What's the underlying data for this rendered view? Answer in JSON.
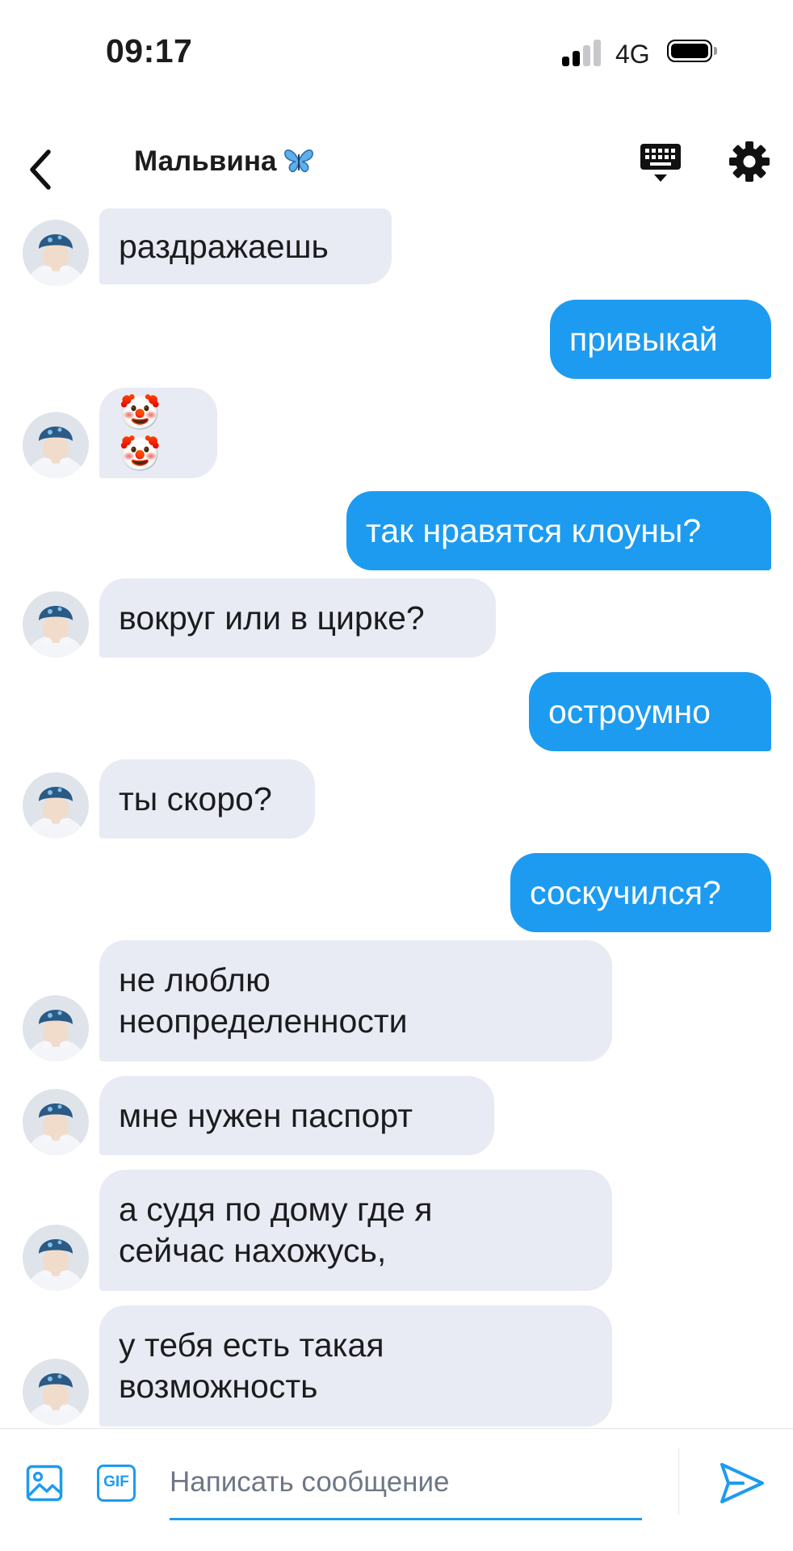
{
  "status_bar": {
    "time": "09:17",
    "network": "4G",
    "signal_level": "2 of 4 bars",
    "battery_level": 0.85
  },
  "header": {
    "contact_name": "Мальвина",
    "back_icon": "chevron-left-icon",
    "keyboard_icon": "keyboard-icon",
    "settings_icon": "gear-icon"
  },
  "messages": [
    {
      "direction": "in",
      "text": "раздражаешь"
    },
    {
      "direction": "out",
      "text": "привыкай"
    },
    {
      "direction": "in",
      "text": "🤡🤡"
    },
    {
      "direction": "out",
      "text": "так нравятся клоуны?"
    },
    {
      "direction": "in",
      "text": "вокруг или в цирке?"
    },
    {
      "direction": "out",
      "text": "остроумно"
    },
    {
      "direction": "in",
      "text": "ты скоро?"
    },
    {
      "direction": "out",
      "text": "соскучился?"
    },
    {
      "direction": "in",
      "text": "не люблю\nнеопределенности"
    },
    {
      "direction": "in",
      "text": "мне нужен паспорт"
    },
    {
      "direction": "in",
      "text": "а судя по дому где я\nсейчас нахожусь,"
    },
    {
      "direction": "in",
      "text": "у тебя есть такая\nвозможность"
    }
  ],
  "composer": {
    "gif_label": "GIF",
    "placeholder": "Написать сообщение",
    "value": ""
  },
  "colors": {
    "outgoing_bubble": "#1d9bf0",
    "incoming_bubble": "#e8ebf4",
    "accent": "#1d9bf0"
  }
}
